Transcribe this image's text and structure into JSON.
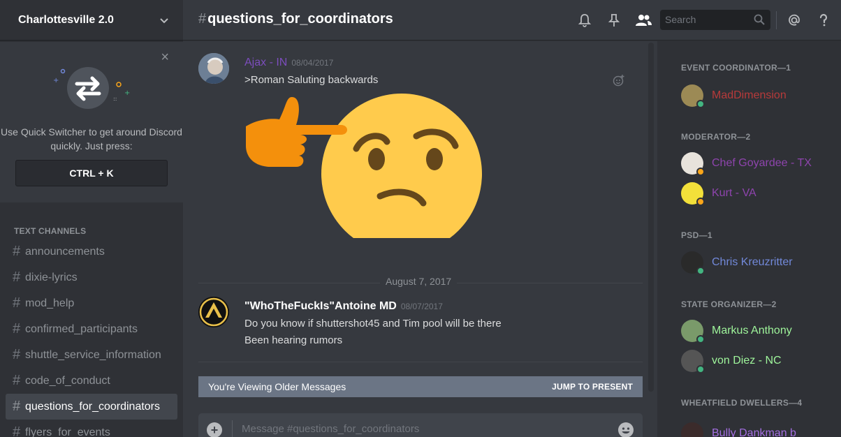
{
  "server": {
    "name": "Charlottesville 2.0"
  },
  "quick_switcher": {
    "text": "Use Quick Switcher to get around Discord quickly. Just press:",
    "shortcut": "CTRL + K",
    "close": "×"
  },
  "text_channels": {
    "category": "TEXT CHANNELS",
    "items": [
      {
        "name": "announcements"
      },
      {
        "name": "dixie-lyrics"
      },
      {
        "name": "mod_help"
      },
      {
        "name": "confirmed_participants"
      },
      {
        "name": "shuttle_service_information"
      },
      {
        "name": "code_of_conduct"
      },
      {
        "name": "questions_for_coordinators",
        "active": true
      },
      {
        "name": "flyers_for_events"
      }
    ]
  },
  "header": {
    "channel": "questions_for_coordinators",
    "hash": "#",
    "search_placeholder": "Search",
    "icons": [
      "bell-icon",
      "pin-icon",
      "members-icon",
      "search-icon",
      "mention-icon",
      "help-icon"
    ]
  },
  "messages": [
    {
      "author": "Ajax - IN",
      "author_color": "#7c4dbd",
      "timestamp": "08/04/2017",
      "lines": [
        ">Roman Saluting backwards"
      ],
      "attachment": "thinking-emoji-pointing-finger"
    },
    {
      "author": "\"WhoTheFuckIs\"Antoine MD",
      "author_color": "#ffffff",
      "timestamp": "08/07/2017",
      "lines": [
        "Do you know if shuttershot45 and Tim pool will be there",
        "Been hearing rumors"
      ]
    }
  ],
  "date_divider": "August 7, 2017",
  "older_banner": {
    "text": "You're Viewing Older Messages",
    "jump": "JUMP TO PRESENT"
  },
  "composer": {
    "placeholder": "Message #questions_for_coordinators"
  },
  "member_list": {
    "roles": [
      {
        "title": "EVENT COORDINATOR—1",
        "members": [
          {
            "name": "MadDimension",
            "color": "#b73a3a",
            "status": "#43b581"
          }
        ]
      },
      {
        "title": "MODERATOR—2",
        "members": [
          {
            "name": "Chef Goyardee - TX",
            "color": "#8e44ad",
            "status": "#faa61a"
          },
          {
            "name": "Kurt - VA",
            "color": "#8e44ad",
            "status": "#faa61a"
          }
        ]
      },
      {
        "title": "PSD—1",
        "members": [
          {
            "name": "Chris Kreuzritter",
            "color": "#7289da",
            "status": "#43b581"
          }
        ]
      },
      {
        "title": "STATE ORGANIZER—2",
        "members": [
          {
            "name": "Markus Anthony",
            "color": "#9ff59b",
            "status": "#43b581"
          },
          {
            "name": "von Diez - NC",
            "color": "#9ff59b",
            "status": "#43b581"
          }
        ]
      },
      {
        "title": "WHEATFIELD DWELLERS—4",
        "members": [
          {
            "name": "Bully Dankman b",
            "color": "#a36ee0",
            "status": "#43b581"
          }
        ]
      }
    ]
  }
}
